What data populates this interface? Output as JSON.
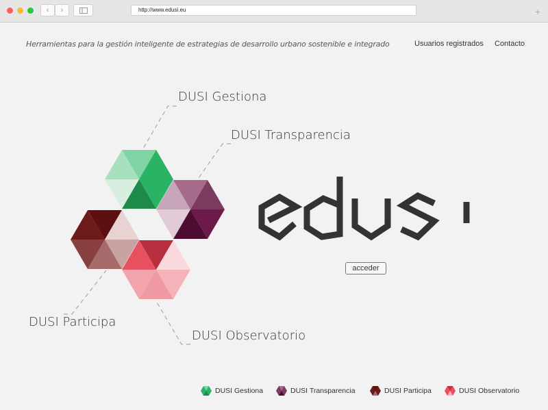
{
  "browser": {
    "url": "http://www.edusi.eu",
    "back_label": "‹",
    "forward_label": "›",
    "sidebar_icon": "sidebar-icon",
    "new_tab_label": "+"
  },
  "header": {
    "tagline": "Herramientas para la gestión inteligente de estrategias de desarrollo urbano sostenible e integrado",
    "nav": [
      "Usuarios registrados",
      "Contacto"
    ]
  },
  "callouts": {
    "gestiona": "DUSI Gestiona",
    "transparencia": "DUSI Transparencia",
    "participa": "DUSI Participa",
    "observatorio": "DUSI Observatorio"
  },
  "logo": {
    "text": "edusi",
    "color": "#333333"
  },
  "cta": {
    "label": "acceder"
  },
  "legend": [
    {
      "label": "DUSI Gestiona",
      "color": "#2bb365"
    },
    {
      "label": "DUSI Transparencia",
      "color": "#7b3a5f"
    },
    {
      "label": "DUSI Participa",
      "color": "#6e1a1a"
    },
    {
      "label": "DUSI Observatorio",
      "color": "#e85060"
    }
  ]
}
